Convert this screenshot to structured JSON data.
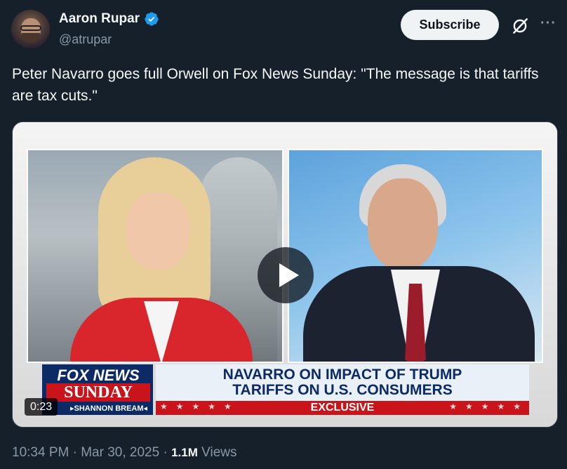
{
  "author": {
    "name": "Aaron Rupar",
    "handle": "@atrupar",
    "verified": true,
    "avatar_icon": "avatar"
  },
  "actions": {
    "subscribe_label": "Subscribe",
    "grok_icon": "grok-icon",
    "more_label": "···"
  },
  "tweet": {
    "text": "Peter Navarro goes full Orwell on Fox News Sunday: \"The message is that tariffs are tax cuts.\""
  },
  "video": {
    "duration": "0:23",
    "lower_third": {
      "network": "FOX NEWS",
      "show": "SUNDAY",
      "host": "▸SHANNON BREAM◂",
      "headline_line1": "NAVARRO ON IMPACT OF TRUMP",
      "headline_line2": "TARIFFS ON U.S. CONSUMERS",
      "tag": "EXCLUSIVE"
    }
  },
  "meta": {
    "time": "10:34 PM",
    "date": "Mar 30, 2025",
    "views_count": "1.1M",
    "views_label": "Views",
    "separator": "·"
  },
  "colors": {
    "background": "#15202b",
    "verified_blue": "#1d9bf0",
    "secondary_text": "#8b98a5",
    "fox_red": "#c9141c",
    "fox_navy": "#0b2a66"
  }
}
